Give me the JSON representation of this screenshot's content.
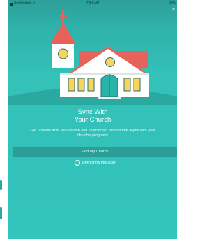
{
  "status_bar": {
    "carrier": "SwiftMobile",
    "time": "7:54 AM",
    "battery": "99%"
  },
  "icons": {
    "close": "close-icon",
    "wifi": "wifi-icon",
    "church": "church-illustration"
  },
  "onboarding": {
    "title_line1": "Sync With",
    "title_line2": "Your Church",
    "description": "Get updates from your church and customized content that aligns with your church's programs",
    "find_button_label": "Find My Church",
    "dont_show_label": "Don't show this again"
  },
  "colors": {
    "background": "#33c1b8",
    "button": "#2b9e97",
    "roof": "#e8625c",
    "walls": "#ffffff",
    "windows": "#f7d55a",
    "door": "#2ab3a9"
  }
}
